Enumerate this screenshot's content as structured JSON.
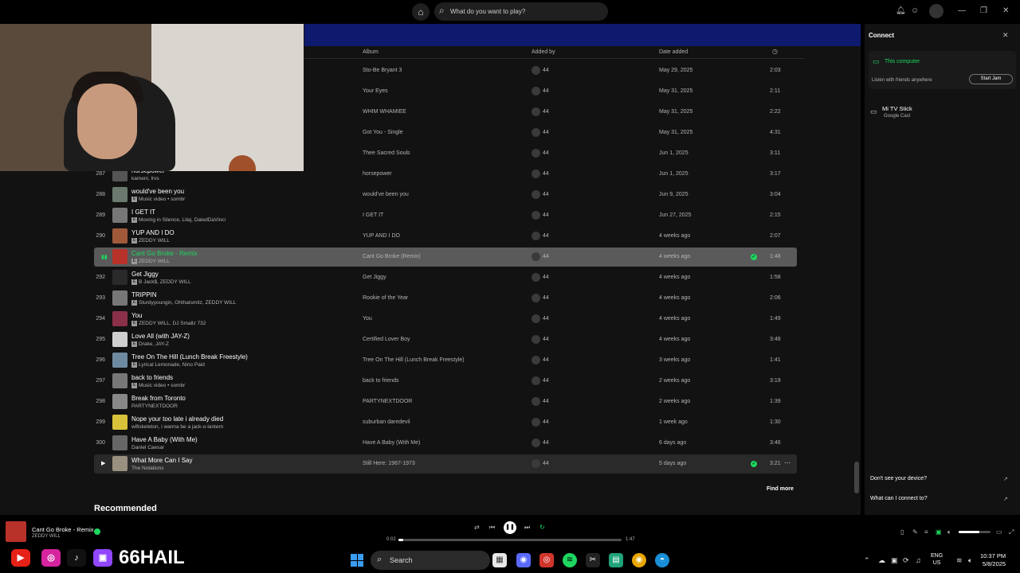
{
  "topbar": {
    "search_placeholder": "What do you want to play?",
    "icons": [
      "home-icon",
      "search-icon",
      "browse-icon",
      "bell-icon",
      "users-icon",
      "profile-icon",
      "minimize-icon",
      "maximize-icon",
      "close-icon"
    ]
  },
  "table": {
    "headers": {
      "album": "Album",
      "added_by": "Added by",
      "date_added": "Date added",
      "duration_icon": "clock-icon"
    },
    "upper_rows": [
      {
        "album": "Sto-Be Bryant 3",
        "added_by": "44",
        "date": "May 29, 2025",
        "duration": "2:03"
      },
      {
        "album": "Your Eyes",
        "added_by": "44",
        "date": "May 31, 2025",
        "duration": "2:11"
      },
      {
        "album": "WHIM WHAMIEE",
        "added_by": "44",
        "date": "May 31, 2025",
        "duration": "2:22"
      },
      {
        "album": "Got You - Single",
        "added_by": "44",
        "date": "May 31, 2025",
        "duration": "4:31"
      },
      {
        "album": "Thee Sacred Souls",
        "added_by": "44",
        "date": "Jun 1, 2025",
        "duration": "3:11"
      }
    ],
    "rows": [
      {
        "num": "287",
        "title": "horsepower",
        "artist": "kameni, lrvs",
        "explicit": false,
        "album": "horsepower",
        "added_by": "44",
        "date": "Jun 1, 2025",
        "duration": "3:17",
        "saved": false,
        "thumb": "#555"
      },
      {
        "num": "288",
        "title": "would've been you",
        "artist": "Music video • sombr",
        "explicit": true,
        "album": "would've been you",
        "added_by": "44",
        "date": "Jun 9, 2025",
        "duration": "3:04",
        "saved": false,
        "thumb": "#6a7a6e"
      },
      {
        "num": "289",
        "title": "I GET IT",
        "artist": "Moving in Silence, Lilaj, DaledDaVinci",
        "explicit": true,
        "album": "I GET IT",
        "added_by": "44",
        "date": "Jun 27, 2025",
        "duration": "2:15",
        "saved": false,
        "thumb": "#777"
      },
      {
        "num": "290",
        "title": "YUP AND I DO",
        "artist": "ZEDDY WILL",
        "explicit": true,
        "album": "YUP AND I DO",
        "added_by": "44",
        "date": "4 weeks ago",
        "duration": "2:07",
        "saved": false,
        "thumb": "#a05a3a"
      },
      {
        "num": "",
        "title": "Cant Go Broke - Remix",
        "artist": "ZEDDY WILL",
        "explicit": true,
        "album": "Cant Go Broke (Remix)",
        "added_by": "44",
        "date": "4 weeks ago",
        "duration": "1:48",
        "saved": true,
        "thumb": "#b8322a",
        "state": "playing"
      },
      {
        "num": "292",
        "title": "Get Jiggy",
        "artist": "B Jack$, ZEDDY WILL",
        "explicit": true,
        "album": "Get Jiggy",
        "added_by": "44",
        "date": "4 weeks ago",
        "duration": "1:58",
        "saved": false,
        "thumb": "#2a2a2a"
      },
      {
        "num": "293",
        "title": "TRIPPIN",
        "artist": "Sturdyyoungin, Ohthatsmitz, ZEDDY WILL",
        "explicit": true,
        "album": "Rookie of the Year",
        "added_by": "44",
        "date": "4 weeks ago",
        "duration": "2:06",
        "saved": false,
        "thumb": "#777"
      },
      {
        "num": "294",
        "title": "You",
        "artist": "ZEDDY WILL, DJ Smallz 732",
        "explicit": true,
        "album": "You",
        "added_by": "44",
        "date": "4 weeks ago",
        "duration": "1:49",
        "saved": false,
        "thumb": "#8a3048"
      },
      {
        "num": "295",
        "title": "Love All (with JAY-Z)",
        "artist": "Drake, JAY-Z",
        "explicit": true,
        "album": "Certified Lover Boy",
        "added_by": "44",
        "date": "4 weeks ago",
        "duration": "3:48",
        "saved": false,
        "thumb": "#cfcfcf"
      },
      {
        "num": "296",
        "title": "Tree On The Hill (Lunch Break Freestyle)",
        "artist": "Lyrical Lemonade, Nino Paid",
        "explicit": true,
        "album": "Tree On The Hill (Lunch Break Freestyle)",
        "added_by": "44",
        "date": "3 weeks ago",
        "duration": "1:41",
        "saved": false,
        "thumb": "#6e8aa0"
      },
      {
        "num": "297",
        "title": "back to friends",
        "artist": "Music video • sombr",
        "explicit": true,
        "album": "back to friends",
        "added_by": "44",
        "date": "2 weeks ago",
        "duration": "3:19",
        "saved": false,
        "thumb": "#777"
      },
      {
        "num": "298",
        "title": "Break from Toronto",
        "artist": "PARTYNEXTDOOR",
        "explicit": false,
        "album": "PARTYNEXTDOOR",
        "added_by": "44",
        "date": "2 weeks ago",
        "duration": "1:39",
        "saved": false,
        "thumb": "#888"
      },
      {
        "num": "299",
        "title": "Nope your too late i already died",
        "artist": "wifiskeleton, i wanna be a jack-o-lantern",
        "explicit": false,
        "album": "suburban daredevil",
        "added_by": "44",
        "date": "1 week ago",
        "duration": "1:30",
        "saved": false,
        "thumb": "#d8c23a"
      },
      {
        "num": "300",
        "title": "Have A Baby (With Me)",
        "artist": "Daniel Caesar",
        "explicit": false,
        "album": "Have A Baby (With Me)",
        "added_by": "44",
        "date": "6 days ago",
        "duration": "3:46",
        "saved": false,
        "thumb": "#666"
      },
      {
        "num": "",
        "title": "What More Can I Say",
        "artist": "The Notations",
        "explicit": false,
        "album": "Still Here: 1967-1973",
        "added_by": "44",
        "date": "5 days ago",
        "duration": "3:21",
        "saved": true,
        "thumb": "#9a9080",
        "state": "hover"
      }
    ],
    "find_more": "Find more",
    "recommended": "Recommended"
  },
  "connect_panel": {
    "title": "Connect",
    "current_device": "This computer",
    "current_sub": "Listen with friends anywhere",
    "jam_button": "Start Jam",
    "device_name": "Mi TV Stick",
    "device_type": "Google Cast",
    "link_1": "Don't see your device?",
    "link_2": "What can I connect to?"
  },
  "player": {
    "track_title": "Cant Go Broke - Remix",
    "track_artist": "ZEDDY WILL",
    "time_current": "0:02",
    "time_total": "1:47",
    "progress": 0.02,
    "volume": 0.65
  },
  "overlay": {
    "handle": "66HAIL",
    "socials": [
      "youtube-icon",
      "instagram-icon",
      "tiktok-icon",
      "twitch-icon"
    ]
  },
  "taskbar": {
    "search_label": "Search",
    "lang_1": "ENG",
    "lang_2": "US",
    "time": "10:37 PM",
    "date": "5/8/2025"
  },
  "colors": {
    "accent": "#1ed760",
    "background": "#121212",
    "highlight_row": "#5a5a5a",
    "header_band": "#0e1a6e"
  }
}
